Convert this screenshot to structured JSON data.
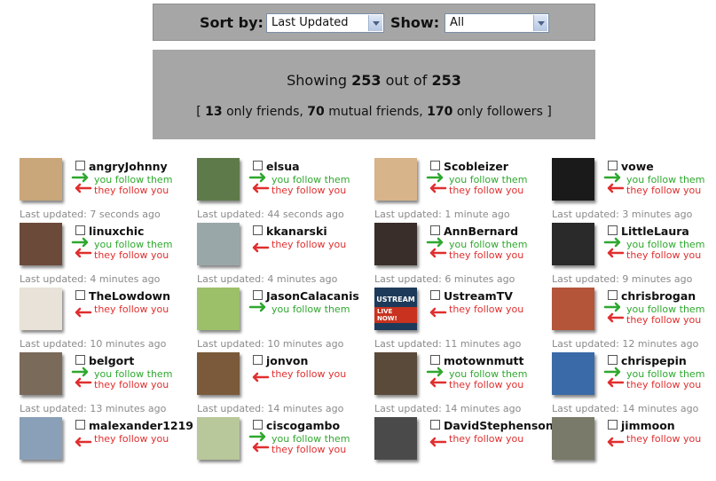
{
  "sort": {
    "label": "Sort by:",
    "value": "Last Updated"
  },
  "show": {
    "label": "Show:",
    "value": "All"
  },
  "summary": {
    "showing_prefix": "Showing",
    "showing_count": "253",
    "out_of": "out of",
    "total": "253",
    "open_bracket": "[",
    "only_friends_count": "13",
    "only_friends_label": "only friends,",
    "mutual_count": "70",
    "mutual_label": "mutual friends,",
    "followers_count": "170",
    "followers_label": "only followers",
    "close_bracket": "]"
  },
  "labels": {
    "you_follow": "you follow them",
    "they_follow": "they follow you"
  },
  "colors": {
    "follow_green": "#2fa82f",
    "follow_red": "#e02f2f",
    "panel_gray": "#a6a6a6"
  },
  "users": [
    {
      "name": "angryJohnny",
      "updated": "Last updated: 7 seconds ago",
      "you_follow": true,
      "they_follow": true,
      "avatar": "#c9a77a"
    },
    {
      "name": "elsua",
      "updated": "Last updated: 44 seconds ago",
      "you_follow": true,
      "they_follow": true,
      "avatar": "#5f7a4a"
    },
    {
      "name": "Scobleizer",
      "updated": "Last updated: 1 minute ago",
      "you_follow": true,
      "they_follow": true,
      "avatar": "#d8b48a"
    },
    {
      "name": "vowe",
      "updated": "Last updated: 3 minutes ago",
      "you_follow": true,
      "they_follow": true,
      "avatar": "#1a1a1a"
    },
    {
      "name": "linuxchic",
      "updated": "Last updated: 4 minutes ago",
      "you_follow": true,
      "they_follow": true,
      "avatar": "#6b4a3a"
    },
    {
      "name": "kkanarski",
      "updated": "Last updated: 4 minutes ago",
      "you_follow": false,
      "they_follow": true,
      "avatar": "#9aa7a8"
    },
    {
      "name": "AnnBernard",
      "updated": "Last updated: 6 minutes ago",
      "you_follow": true,
      "they_follow": true,
      "avatar": "#3a2e2a"
    },
    {
      "name": "LittleLaura",
      "updated": "Last updated: 9 minutes ago",
      "you_follow": true,
      "they_follow": true,
      "avatar": "#2a2a2a"
    },
    {
      "name": "TheLowdown",
      "updated": "Last updated: 10 minutes ago",
      "you_follow": false,
      "they_follow": true,
      "avatar": "#e8e2d8"
    },
    {
      "name": "JasonCalacanis",
      "updated": "Last updated: 10 minutes ago",
      "you_follow": true,
      "they_follow": false,
      "avatar": "#9cc06a"
    },
    {
      "name": "UstreamTV",
      "updated": "Last updated: 11 minutes ago",
      "you_follow": false,
      "they_follow": true,
      "avatar": "#1d3a5a",
      "avatar_text": "USTREAM",
      "avatar_sub": "LIVE NOW!"
    },
    {
      "name": "chrisbrogan",
      "updated": "Last updated: 12 minutes ago",
      "you_follow": true,
      "they_follow": true,
      "avatar": "#b4553a"
    },
    {
      "name": "belgort",
      "updated": "Last updated: 13 minutes ago",
      "you_follow": true,
      "they_follow": true,
      "avatar": "#7a6a5a"
    },
    {
      "name": "jonvon",
      "updated": "Last updated: 14 minutes ago",
      "you_follow": false,
      "they_follow": true,
      "avatar": "#7a5a3a"
    },
    {
      "name": "motownmutt",
      "updated": "Last updated: 14 minutes ago",
      "you_follow": true,
      "they_follow": true,
      "avatar": "#5a4a3a"
    },
    {
      "name": "chrispepin",
      "updated": "Last updated: 14 minutes ago",
      "you_follow": true,
      "they_follow": true,
      "avatar": "#3a6aa8"
    },
    {
      "name": "malexander1219",
      "updated": "",
      "you_follow": false,
      "they_follow": true,
      "avatar": "#8aa0b8"
    },
    {
      "name": "ciscogambo",
      "updated": "",
      "you_follow": true,
      "they_follow": true,
      "avatar": "#b8c89a"
    },
    {
      "name": "DavidStephenson",
      "updated": "",
      "you_follow": false,
      "they_follow": true,
      "avatar": "#4a4a4a"
    },
    {
      "name": "jimmoon",
      "updated": "",
      "you_follow": false,
      "they_follow": true,
      "avatar": "#7a7a6a"
    }
  ]
}
